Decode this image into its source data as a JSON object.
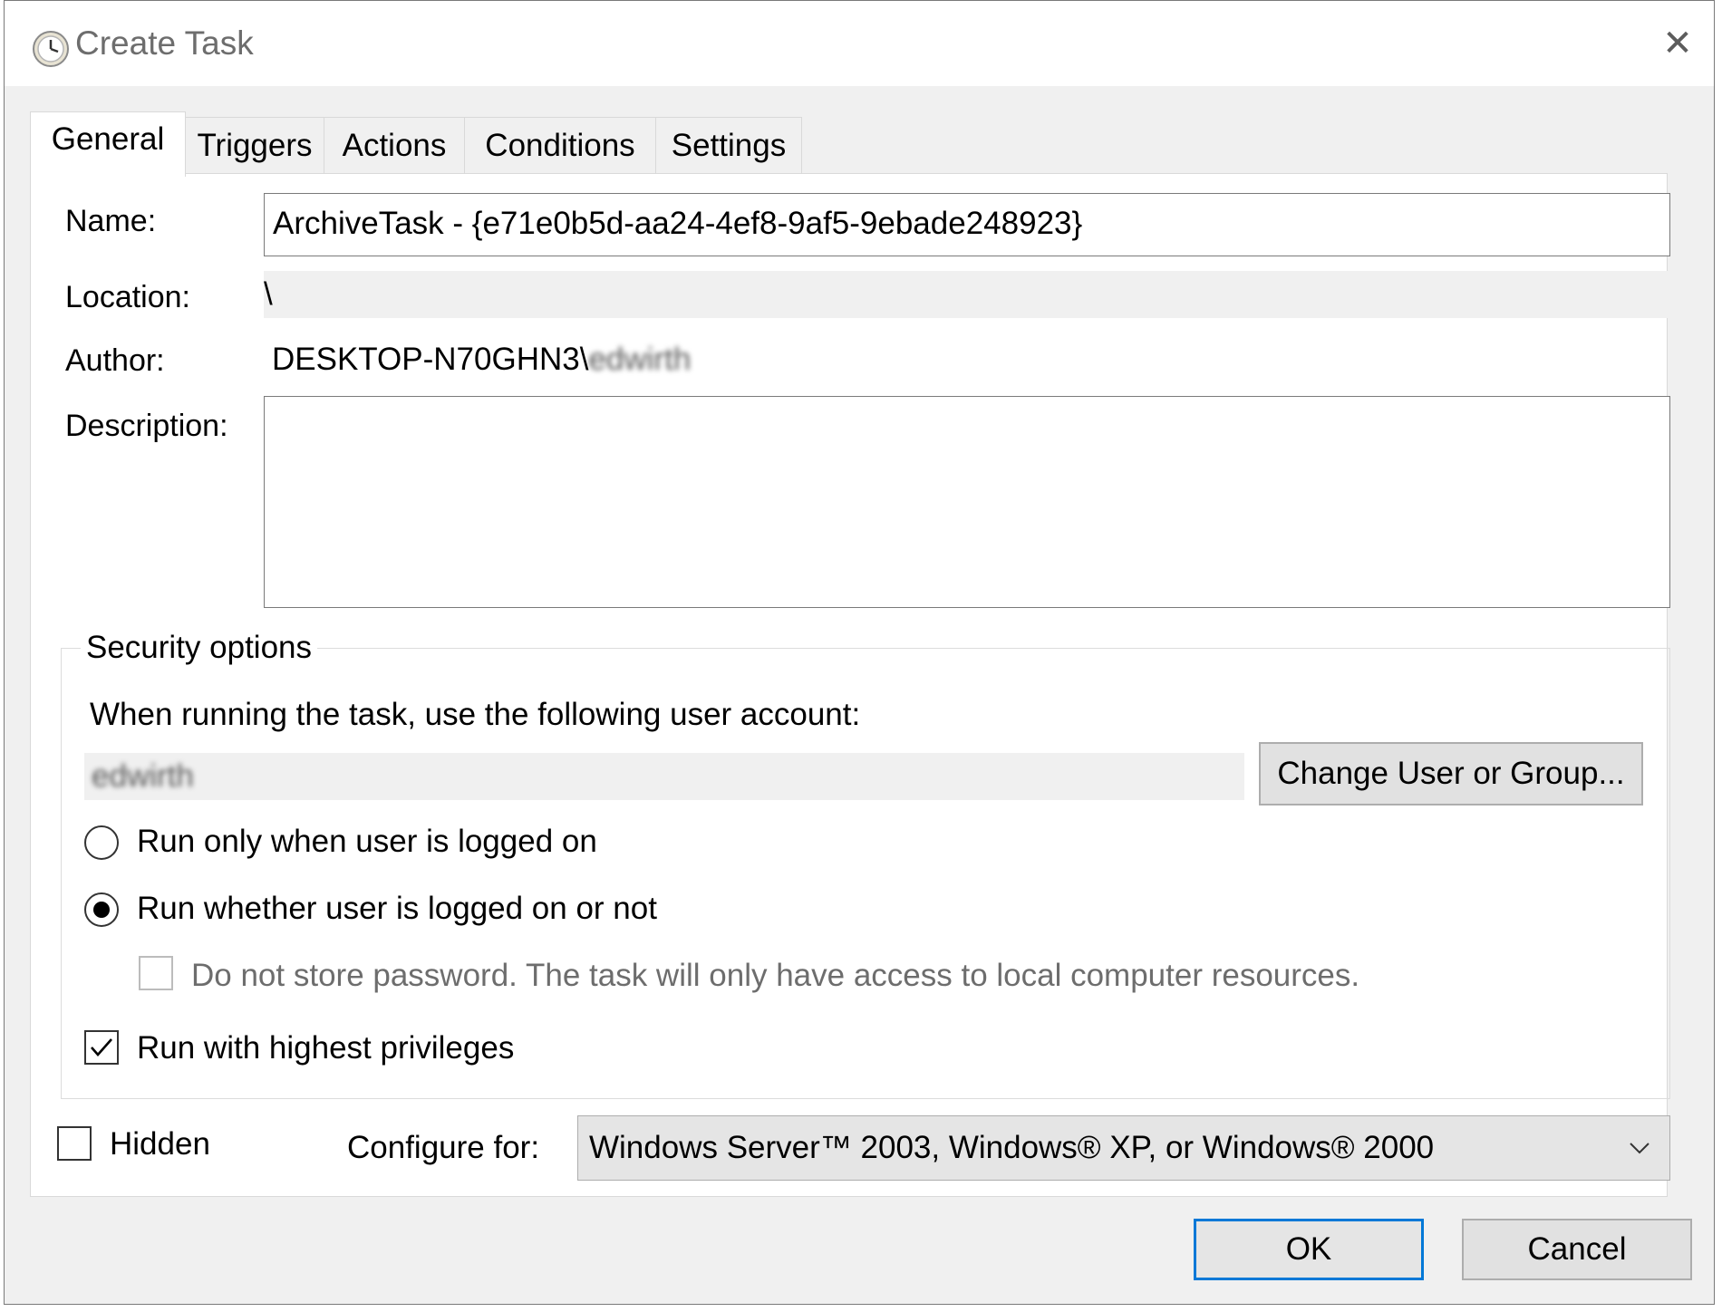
{
  "window": {
    "title": "Create Task",
    "close_glyph": "✕"
  },
  "tabs": [
    {
      "label": "General",
      "active": true
    },
    {
      "label": "Triggers",
      "active": false
    },
    {
      "label": "Actions",
      "active": false
    },
    {
      "label": "Conditions",
      "active": false
    },
    {
      "label": "Settings",
      "active": false
    }
  ],
  "general": {
    "name_label": "Name:",
    "name_value": "ArchiveTask - {e71e0b5d-aa24-4ef8-9af5-9ebade248923}",
    "location_label": "Location:",
    "location_value": "\\",
    "author_label": "Author:",
    "author_value_prefix": "DESKTOP-N70GHN3\\",
    "author_value_blurred": "edwirth",
    "description_label": "Description:",
    "description_value": ""
  },
  "security": {
    "group_title": "Security options",
    "account_prompt": "When running the task, use the following user account:",
    "account_value_blurred": "edwirth",
    "change_button": "Change User or Group...",
    "radio_logged_on": {
      "label": "Run only when user is logged on",
      "checked": false
    },
    "radio_whether": {
      "label": "Run whether user is logged on or not",
      "checked": true
    },
    "no_store_password": {
      "label": "Do not store password.  The task will only have access to local computer resources.",
      "checked": false,
      "disabled": true
    },
    "highest_privileges": {
      "label": "Run with highest privileges",
      "checked": true
    }
  },
  "footer_options": {
    "hidden": {
      "label": "Hidden",
      "checked": false
    },
    "configure_label": "Configure for:",
    "configure_value": "Windows Server™ 2003, Windows® XP, or Windows® 2000"
  },
  "buttons": {
    "ok": "OK",
    "cancel": "Cancel"
  },
  "colors": {
    "dialog_bg": "#f0f0f0",
    "panel_bg": "#ffffff",
    "ok_focus_border": "#0078d7"
  },
  "icons": [
    "task-scheduler-clock-icon",
    "close-icon",
    "chevron-down-icon",
    "checkmark-icon"
  ]
}
